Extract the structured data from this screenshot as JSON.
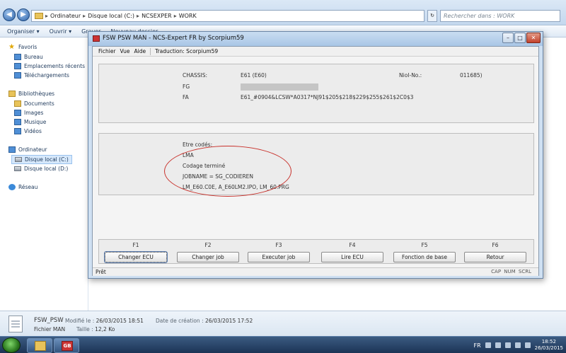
{
  "explorer": {
    "address": [
      "Ordinateur",
      "Disque local (C:)",
      "NCSEXPER",
      "WORK"
    ],
    "search_placeholder": "Rechercher dans : WORK",
    "toolbar": [
      "Organiser ▾",
      "Ouvrir ▾",
      "Graver",
      "Nouveau dossier"
    ],
    "sidebar": {
      "favorites_header": "Favoris",
      "favorites": [
        "Bureau",
        "Emplacements récents",
        "Téléchargements"
      ],
      "libraries_header": "Bibliothèques",
      "libraries": [
        "Documents",
        "Images",
        "Musique",
        "Vidéos"
      ],
      "computer_header": "Ordinateur",
      "drives": [
        "Disque local (C:)",
        "Disque local (D:)"
      ],
      "network": "Réseau"
    },
    "details": {
      "name": "FSW_PSW",
      "modified_label": "Modifié le :",
      "modified_value": "26/03/2015 18:51",
      "created_label": "Date de création :",
      "created_value": "26/03/2015 17:52",
      "type": "Fichier MAN",
      "size_label": "Taille :",
      "size_value": "12,2 Ko"
    }
  },
  "taskbar": {
    "app_label": "GB",
    "lang": "FR",
    "time": "18:52",
    "date": "26/03/2015"
  },
  "app": {
    "title": "FSW PSW MAN - NCS-Expert FR by Scorpium59",
    "window_buttons": [
      "–",
      "□",
      "✕"
    ],
    "menu": [
      "Fichier",
      "Vue",
      "Aide",
      "Traduction: Scorpium59"
    ],
    "vehicle": {
      "chassis_label": "CHASSIS:",
      "chassis_value": "E61 (E60)",
      "nio_label": "NioI-No.:",
      "nio_value": "011685)",
      "fg_label": "FG",
      "fa_label": "FA",
      "fa_value": "E61_#0904&LCSW*A0317*NJ91$205$218$229$255$261$2C0$3"
    },
    "result_lines": [
      "Etre codés:",
      "LMA",
      "Codage terminé",
      "JOBNAME = SG_CODIEREN",
      "LM_E60.C0E, A_E60LM2.IPO, LM_60.PRG"
    ],
    "fkeys": [
      {
        "key": "F1",
        "label": "Changer ECU"
      },
      {
        "key": "F2",
        "label": "Changer job"
      },
      {
        "key": "F3",
        "label": "Executer job"
      },
      {
        "key": "F4",
        "label": "Lire ECU"
      },
      {
        "key": "F5",
        "label": "Fonction de base"
      },
      {
        "key": "F6",
        "label": "Retour"
      }
    ],
    "status_left": "Prêt",
    "status_right": "CAP NUM SCRL"
  },
  "colors": {
    "annotation_oval": "#c8302a",
    "title_bar": "#a9c6e6",
    "taskbar": "#1c3455"
  }
}
